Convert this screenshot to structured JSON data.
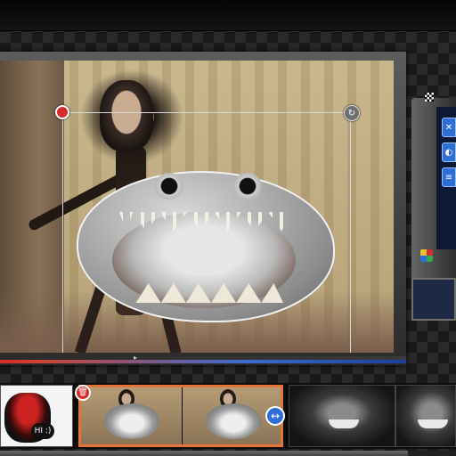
{
  "colors": {
    "accent_red": "#d52b2b",
    "accent_blue": "#2f6ed6",
    "selection_orange": "#e4743a"
  },
  "canvas": {
    "marker": "▸",
    "handles": {
      "delete_icon": "trash-icon",
      "delete_glyph": "",
      "rotate_icon": "rotate-icon",
      "rotate_glyph": "↻",
      "scale_icon": "resize-diagonal-icon",
      "scale_glyph": "⤡"
    }
  },
  "side_panel": {
    "buttons": [
      {
        "icon": "tool-1-icon",
        "glyph": "✕"
      },
      {
        "icon": "tool-2-icon",
        "glyph": "◐"
      },
      {
        "icon": "tool-3-icon",
        "glyph": "≡"
      }
    ]
  },
  "timeline": {
    "thumb_1_caption": "HI :)",
    "delete_glyph": "🗑",
    "resize_glyph": "↔"
  }
}
